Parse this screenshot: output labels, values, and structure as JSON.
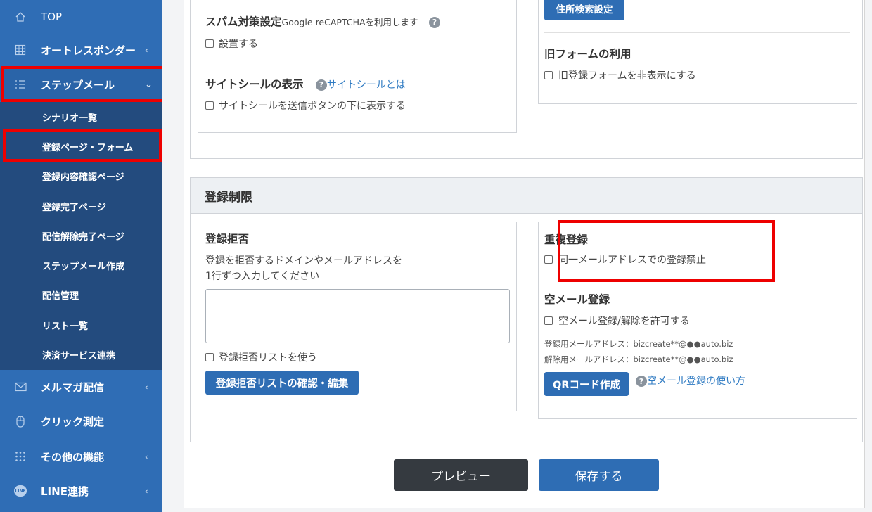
{
  "sidebar": {
    "top": {
      "label": "TOP",
      "icon": "home-icon"
    },
    "autoresponder": {
      "label": "オートレスポンダー",
      "icon": "grid-icon"
    },
    "stepmail": {
      "label": "ステップメール",
      "icon": "list-icon"
    },
    "stepmail_sub": [
      {
        "label": "シナリオ一覧"
      },
      {
        "label": "登録ページ・フォーム"
      },
      {
        "label": "登録内容確認ページ"
      },
      {
        "label": "登録完了ページ"
      },
      {
        "label": "配信解除完了ページ"
      },
      {
        "label": "ステップメール作成"
      },
      {
        "label": "配信管理"
      },
      {
        "label": "リスト一覧"
      },
      {
        "label": "決済サービス連携"
      }
    ],
    "magazine": {
      "label": "メルマガ配信",
      "icon": "mail-icon"
    },
    "click": {
      "label": "クリック測定",
      "icon": "mouse-icon"
    },
    "other": {
      "label": "その他の機能",
      "icon": "dots-grid-icon"
    },
    "line": {
      "label": "LINE連携",
      "icon": "line-icon",
      "icon_text": "LINE"
    },
    "chevron_left": "‹",
    "chevron_down": "⌄"
  },
  "top_section": {
    "spam": {
      "title": "スパム対策設定",
      "note": "Google reCAPTCHAを利用します",
      "checkbox": "設置する",
      "help": "?"
    },
    "siteseal": {
      "title": "サイトシールの表示",
      "link": "サイトシールとは",
      "checkbox": "サイトシールを送信ボタンの下に表示する",
      "help": "?"
    },
    "address_button": "住所検索設定",
    "oldform": {
      "title": "旧フォームの利用",
      "checkbox": "旧登録フォームを非表示にする"
    }
  },
  "restriction": {
    "header": "登録制限",
    "reject": {
      "title": "登録拒否",
      "desc1": "登録を拒否するドメインやメールアドレスを",
      "desc2": "1行ずつ入力してください",
      "textarea_value": "",
      "checkbox": "登録拒否リストを使う",
      "button": "登録拒否リストの確認・編集"
    },
    "duplicate": {
      "title": "重複登録",
      "checkbox": "同一メールアドレスでの登録禁止"
    },
    "empty": {
      "title": "空メール登録",
      "checkbox": "空メール登録/解除を許可する",
      "register_addr": "登録用メールアドレス：bizcreate**@●●auto.biz",
      "cancel_addr": "解除用メールアドレス：bizcreate**@●●auto.biz",
      "qr_button": "QRコード作成",
      "howto_link": "空メール登録の使い方",
      "help": "?"
    }
  },
  "footer": {
    "preview": "プレビュー",
    "save": "保存する"
  },
  "colors": {
    "sidebar": "#2f6db5",
    "submenu": "#234b7e",
    "button": "#2e6db4",
    "preview": "#353a40",
    "highlight": "#ee0000"
  }
}
